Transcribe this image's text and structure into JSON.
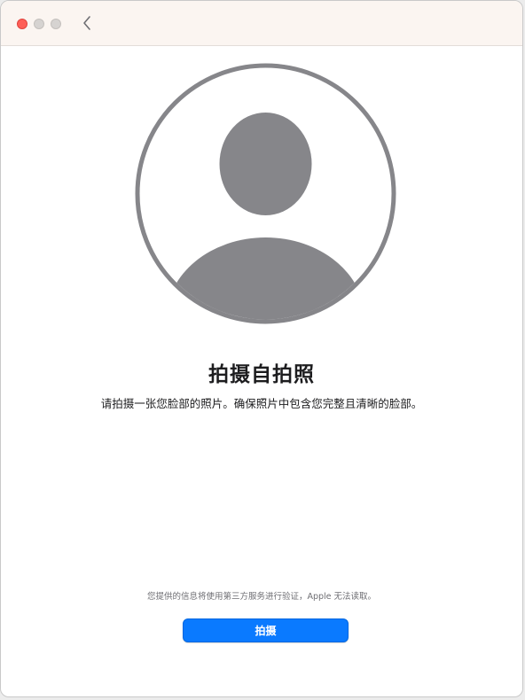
{
  "window": {
    "controls": [
      "close",
      "minimize",
      "zoom"
    ],
    "back_icon": "chevron-left-icon"
  },
  "main": {
    "avatar_icon": "person-silhouette-icon",
    "title": "拍摄自拍照",
    "subtitle": "请拍摄一张您脸部的照片。确保照片中包含您完整且清晰的脸部。",
    "privacy_note": "您提供的信息将使用第三方服务进行验证，Apple 无法读取。",
    "capture_label": "拍摄"
  },
  "colors": {
    "accent": "#0a7aff",
    "titlebar_bg": "#fbf5f1",
    "avatar_gray": "#86868a"
  }
}
